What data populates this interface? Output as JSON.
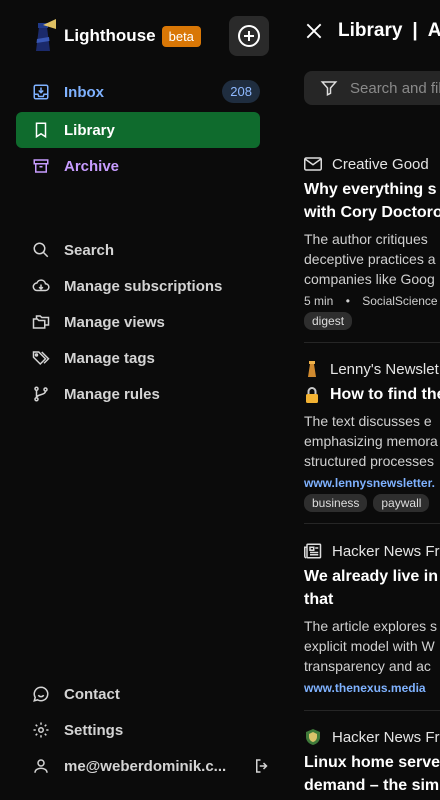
{
  "brand": {
    "name": "Lighthouse",
    "badge": "beta"
  },
  "nav": {
    "inbox": {
      "label": "Inbox",
      "count": "208"
    },
    "library": {
      "label": "Library"
    },
    "archive": {
      "label": "Archive"
    }
  },
  "tools": [
    "Search",
    "Manage subscriptions",
    "Manage views",
    "Manage tags",
    "Manage rules"
  ],
  "footer": {
    "contact": "Contact",
    "settings": "Settings",
    "account": "me@weberdominik.c..."
  },
  "main": {
    "title": "Library",
    "separator": "|",
    "view": "Al",
    "search_placeholder": "Search and fil"
  },
  "articles": [
    {
      "source": "Creative Good",
      "title_lines": [
        "Why everything s",
        "with Cory Doctoro"
      ],
      "desc_lines": [
        "The author critiques",
        "deceptive practices a",
        "companies like Goog"
      ],
      "read_time": "5 min",
      "site": "SocialScience",
      "tags": [
        "digest"
      ]
    },
    {
      "source": "Lenny's Newslet",
      "title_lines": [
        "How to find the"
      ],
      "desc_lines": [
        "The text discusses e",
        "emphasizing memora",
        "structured processes"
      ],
      "link": "www.lennysnewsletter.",
      "tags": [
        "business",
        "paywall"
      ]
    },
    {
      "source": "Hacker News Fro",
      "title_lines": [
        "We already live in",
        "that"
      ],
      "desc_lines": [
        "The article explores s",
        "explicit model with W",
        "transparency and ac"
      ],
      "link": "www.thenexus.media"
    },
    {
      "source": "Hacker News Fro",
      "title_lines": [
        "Linux home serve",
        "demand – the sim"
      ]
    }
  ],
  "colors": {
    "accent_library": "#0f6b2d",
    "inbox": "#7fb2ff",
    "archive": "#c79cff",
    "beta": "#d97706"
  }
}
